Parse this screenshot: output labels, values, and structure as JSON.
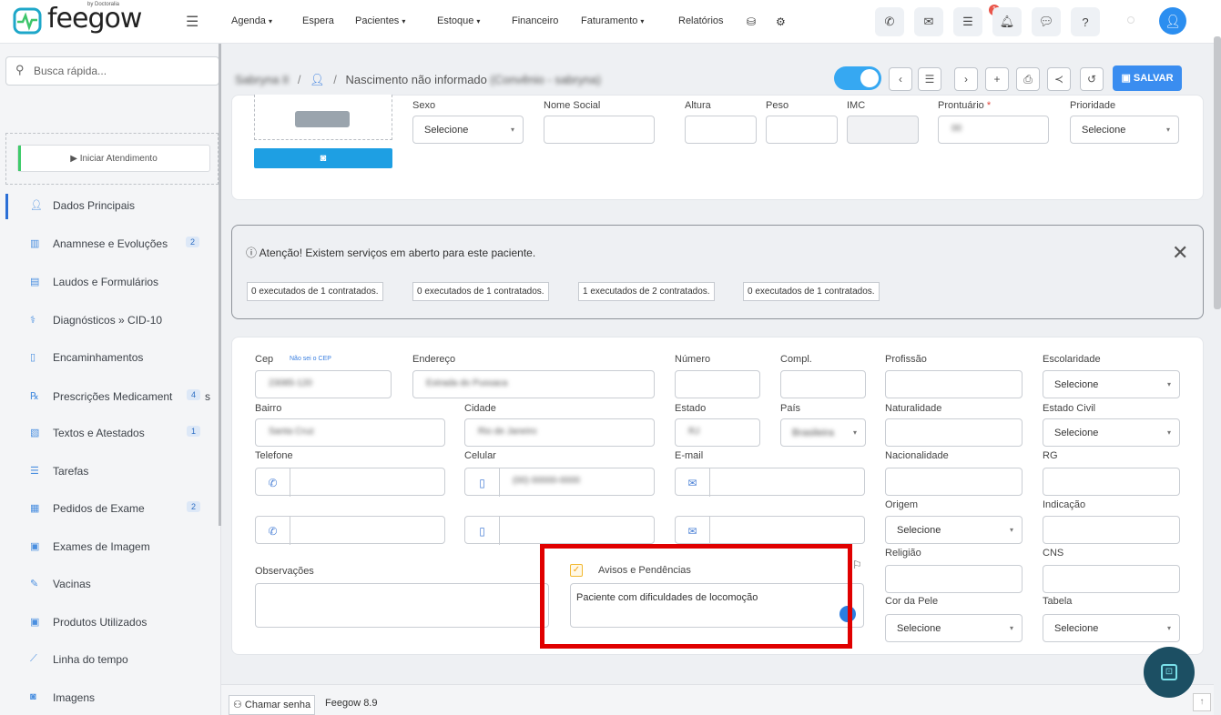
{
  "app": {
    "logo": "feegow",
    "logo_sub": "by Doctoralia"
  },
  "nav": {
    "items": [
      {
        "label": "Agenda",
        "dropdown": true
      },
      {
        "label": "Espera",
        "dropdown": false
      },
      {
        "label": "Pacientes",
        "dropdown": true
      },
      {
        "label": "Estoque",
        "dropdown": true
      },
      {
        "label": "Financeiro",
        "dropdown": false
      },
      {
        "label": "Faturamento",
        "dropdown": true
      },
      {
        "label": "Relatórios",
        "dropdown": false
      }
    ],
    "notification_count": "1"
  },
  "sidebar": {
    "search_placeholder": "Busca rápida...",
    "start_label": "▶ Iniciar Atendimento",
    "items": [
      {
        "label": "Dados Principais",
        "icon": "user-icon",
        "badge": ""
      },
      {
        "label": "Anamnese e Evoluções",
        "icon": "chart-icon",
        "badge": "2"
      },
      {
        "label": "Laudos e Formulários",
        "icon": "form-icon",
        "badge": ""
      },
      {
        "label": "Diagnósticos » CID-10",
        "icon": "diagnosis-icon",
        "badge": ""
      },
      {
        "label": "Encaminhamentos",
        "icon": "document-icon",
        "badge": ""
      },
      {
        "label": "Prescrições Medicament",
        "icon": "pills-icon",
        "badge": "4",
        "suffix": "s"
      },
      {
        "label": "Textos e Atestados",
        "icon": "text-icon",
        "badge": "1"
      },
      {
        "label": "Tarefas",
        "icon": "list-icon",
        "badge": ""
      },
      {
        "label": "Pedidos de Exame",
        "icon": "exam-icon",
        "badge": "2"
      },
      {
        "label": "Exames de Imagem",
        "icon": "image-exam-icon",
        "badge": ""
      },
      {
        "label": "Vacinas",
        "icon": "syringe-icon",
        "badge": ""
      },
      {
        "label": "Produtos Utilizados",
        "icon": "box-icon",
        "badge": ""
      },
      {
        "label": "Linha do tempo",
        "icon": "timeline-icon",
        "badge": ""
      },
      {
        "label": "Imagens",
        "icon": "camera-icon",
        "badge": ""
      }
    ]
  },
  "header": {
    "patient_name": "Sabryna II",
    "sep": "/",
    "birth": "Nascimento não informado",
    "extra": "(Convênio - sabryna)",
    "save_label": "SALVAR"
  },
  "top_form": {
    "sexo_label": "Sexo",
    "sexo_value": "Selecione",
    "nome_social_label": "Nome Social",
    "altura_label": "Altura",
    "peso_label": "Peso",
    "imc_label": "IMC",
    "prontuario_label": "Prontuário",
    "prontuario_req": "*",
    "prontuario_value": "00",
    "prioridade_label": "Prioridade",
    "prioridade_value": "Selecione"
  },
  "warning": {
    "title": "ⓘ Atenção! Existem serviços em aberto para este paciente.",
    "services": [
      "0 executados de 1 contratados.",
      "0 executados de 1 contratados.",
      "1 executados de 2 contratados.",
      "0 executados de 1 contratados."
    ]
  },
  "address": {
    "cep_label": "Cep",
    "cep_link": "Não sei o CEP",
    "cep_value": "23085-120",
    "endereco_label": "Endereço",
    "endereco_value": "Estrada do Pussaca",
    "numero_label": "Número",
    "compl_label": "Compl.",
    "profissao_label": "Profissão",
    "escolaridade_label": "Escolaridade",
    "escolaridade_value": "Selecione",
    "bairro_label": "Bairro",
    "bairro_value": "Santa Cruz",
    "cidade_label": "Cidade",
    "cidade_value": "Rio de Janeiro",
    "estado_label": "Estado",
    "estado_value": "RJ",
    "pais_label": "País",
    "pais_value": "Brasileira",
    "naturalidade_label": "Naturalidade",
    "estado_civil_label": "Estado Civil",
    "estado_civil_value": "Selecione",
    "telefone_label": "Telefone",
    "celular_label": "Celular",
    "celular_value": "(00) 00000-0000",
    "email_label": "E-mail",
    "nacionalidade_label": "Nacionalidade",
    "rg_label": "RG",
    "origem_label": "Origem",
    "origem_value": "Selecione",
    "indicacao_label": "Indicação",
    "religiao_label": "Religião",
    "cns_label": "CNS",
    "cor_pele_label": "Cor da Pele",
    "cor_pele_value": "Selecione",
    "tabela_label": "Tabela",
    "tabela_value": "Selecione",
    "observacoes_label": "Observações",
    "avisos_label": "Avisos e Pendências",
    "avisos_value": "Paciente com dificuldades de locomoção"
  },
  "footer": {
    "chamar_label": "Chamar senha",
    "version": "Feegow 8.9"
  },
  "colors": {
    "accent": "#3a8df0",
    "highlight": "#e00000",
    "fab": "#1c4f63"
  }
}
